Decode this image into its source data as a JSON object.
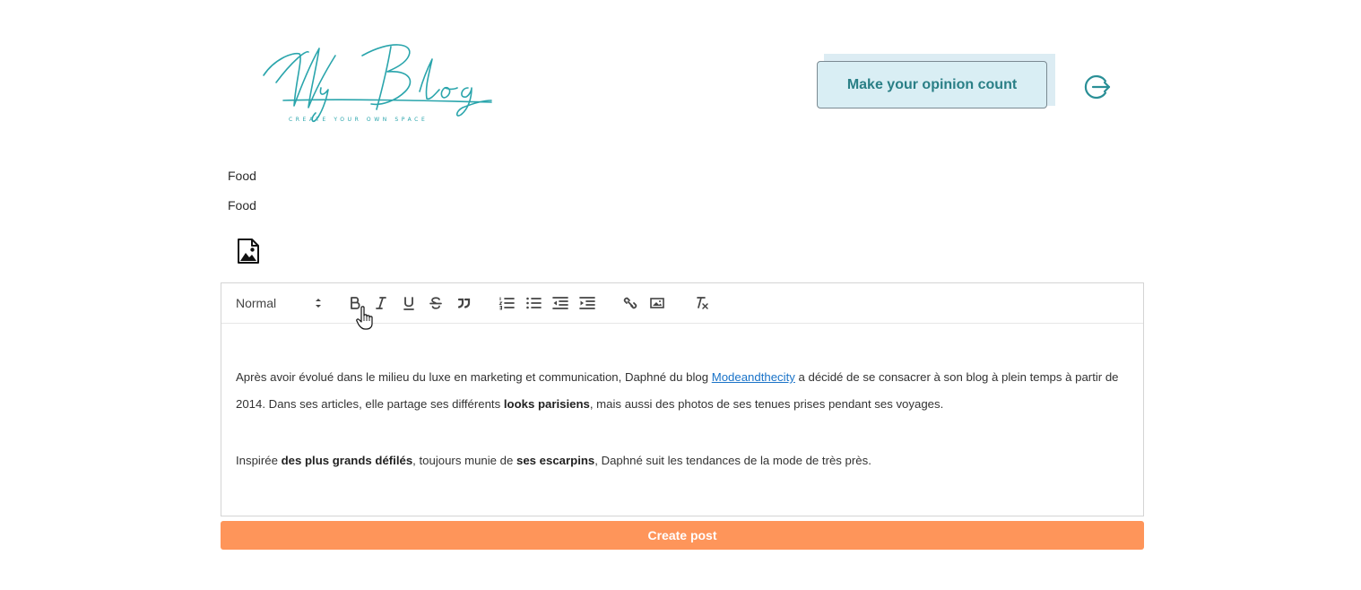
{
  "header": {
    "logo_text": "My Blog",
    "logo_tagline": "CREATE YOUR OWN SPACE",
    "opinion_button_label": "Make your opinion count",
    "logout_icon": "logout-icon"
  },
  "post": {
    "category_1": "Food",
    "category_2": "Food",
    "image_upload_icon": "image-upload-icon"
  },
  "editor": {
    "toolbar": {
      "header_select_value": "Normal",
      "bold_icon": "bold-icon",
      "italic_icon": "italic-icon",
      "underline_icon": "underline-icon",
      "strike_icon": "strikethrough-icon",
      "blockquote_icon": "blockquote-icon",
      "ordered_list_icon": "ordered-list-icon",
      "bullet_list_icon": "bullet-list-icon",
      "outdent_icon": "outdent-icon",
      "indent_icon": "indent-icon",
      "link_icon": "link-icon",
      "image_icon": "image-icon",
      "clean_icon": "clear-formatting-icon"
    },
    "content": {
      "p1_t1": "Après avoir évolué dans le milieu du luxe en marketing et communication, Daphné du blog ",
      "p1_link": "Modeandthecity",
      "p1_t2": " a décidé de se consacrer à son blog à plein temps à partir de 2014. Dans ses articles, elle partage ses différents ",
      "p1_b1": "looks parisiens",
      "p1_t3": ", mais aussi des photos de ses tenues prises pendant ses voyages.",
      "p2_t1": "Inspirée ",
      "p2_b1": "des plus grands défilés",
      "p2_t2": ", toujours munie de ",
      "p2_b2": "ses escarpins",
      "p2_t3": ", Daphné suit les tendances de la mode de très près."
    }
  },
  "actions": {
    "create_post_label": "Create post"
  },
  "colors": {
    "brand_teal": "#2aa5ac",
    "opinion_bg": "#d9eef4",
    "create_button": "#fe955a",
    "link": "#1a73c8"
  }
}
